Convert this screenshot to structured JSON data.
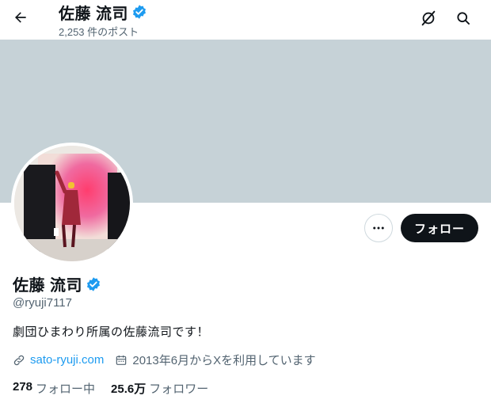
{
  "header": {
    "title": "佐藤 流司",
    "post_count": "2,253 件のポスト"
  },
  "profile": {
    "name": "佐藤 流司",
    "handle": "@ryuji7117",
    "bio": "劇団ひまわり所属の佐藤流司です！",
    "website": "sato-ryuji.com",
    "joined": "2013年6月からXを利用しています",
    "following_count": "278",
    "following_label": "フォロー中",
    "followers_count": "25.6万",
    "followers_label": "フォロワー"
  },
  "actions": {
    "follow_label": "フォロー"
  },
  "colors": {
    "accent": "#1d9bf0",
    "banner": "#c6d2d7",
    "text_primary": "#0f1419",
    "text_secondary": "#536471",
    "follow_button": "#0f1419"
  },
  "icons": {
    "back": "arrow-left-icon",
    "grok": "grok-icon",
    "search": "search-icon",
    "verified": "verified-badge-icon",
    "more": "more-dots-icon",
    "link": "link-icon",
    "calendar": "calendar-icon"
  }
}
